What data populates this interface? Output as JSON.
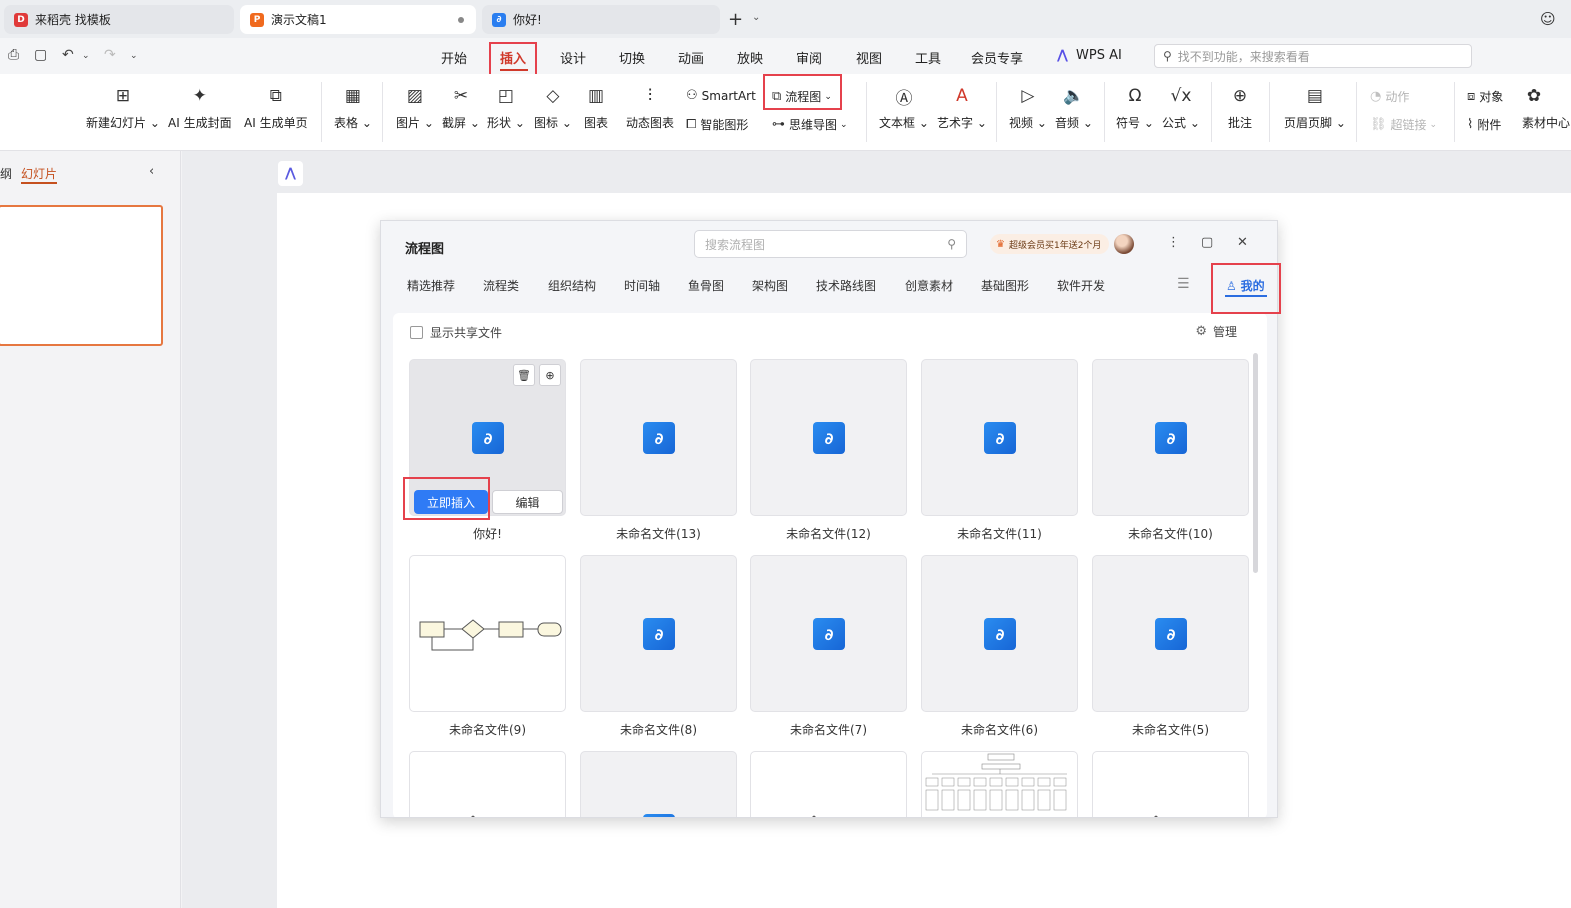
{
  "tabs": [
    {
      "label": "来稻壳 找模板",
      "icon": "docer-icon"
    },
    {
      "label": "演示文稿1",
      "icon": "presentation-icon"
    },
    {
      "label": "你好!",
      "icon": "flowchart-icon"
    }
  ],
  "menu": [
    "开始",
    "插入",
    "设计",
    "切换",
    "动画",
    "放映",
    "审阅",
    "视图",
    "工具",
    "会员专享",
    "WPS AI"
  ],
  "menu_active": "插入",
  "search_placeholder": "找不到功能，来搜索看看",
  "ribbon": {
    "new_slide": "新建幻灯片",
    "ai_cover": "AI 生成封面",
    "ai_page": "AI 生成单页",
    "table": "表格",
    "picture": "图片",
    "screenshot": "截屏",
    "shape": "形状",
    "icon": "图标",
    "chart": "图表",
    "dynamic_chart": "动态图表",
    "smartart": "SmartArt",
    "smart_shape": "智能图形",
    "flowchart": "流程图",
    "mindmap": "思维导图",
    "textbox": "文本框",
    "wordart": "艺术字",
    "video": "视频",
    "audio": "音频",
    "symbol": "符号",
    "formula": "公式",
    "comment": "批注",
    "header_footer": "页眉页脚",
    "action": "动作",
    "hyperlink": "超链接",
    "object": "对象",
    "attachment": "附件",
    "material": "素材中心"
  },
  "left_panel": {
    "tab_outline": "纲",
    "tab_slides": "幻灯片"
  },
  "dialog": {
    "title": "流程图",
    "search_placeholder": "搜索流程图",
    "vip_badge": "超级会员买1年送2个月",
    "categories": [
      "精选推荐",
      "流程类",
      "组织结构",
      "时间轴",
      "鱼骨图",
      "架构图",
      "技术路线图",
      "创意素材",
      "基础图形",
      "软件开发"
    ],
    "mine_tab": "我的",
    "show_shared": "显示共享文件",
    "manage": "管理",
    "insert_button": "立即插入",
    "edit_button": "编辑",
    "files": [
      {
        "name": "你好!"
      },
      {
        "name": "未命名文件(13)"
      },
      {
        "name": "未命名文件(12)"
      },
      {
        "name": "未命名文件(11)"
      },
      {
        "name": "未命名文件(10)"
      },
      {
        "name": "未命名文件(9)"
      },
      {
        "name": "未命名文件(8)"
      },
      {
        "name": "未命名文件(7)"
      },
      {
        "name": "未命名文件(6)"
      },
      {
        "name": "未命名文件(5)"
      }
    ]
  },
  "colors": {
    "accent_menu": "#d0392b",
    "highlight_box": "#e5414c",
    "primary_blue": "#2f7bf5"
  }
}
